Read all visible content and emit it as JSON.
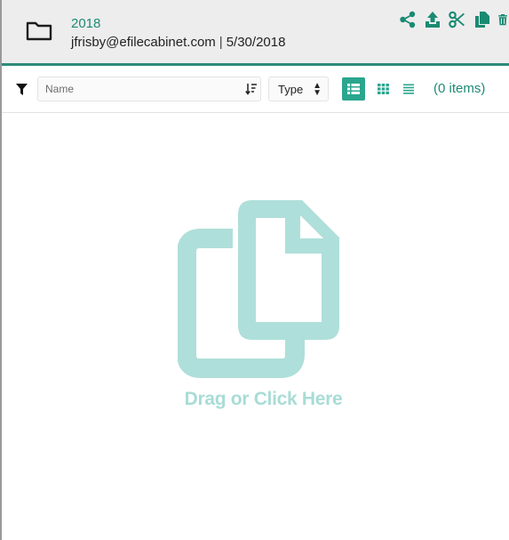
{
  "header": {
    "folder_name": "2018",
    "owner_email": "jfrisby@efilecabinet.com",
    "separator": "|",
    "date": "5/30/2018",
    "accent_color": "#1a8a73",
    "actions": [
      {
        "icon": "share-icon"
      },
      {
        "icon": "upload-icon"
      },
      {
        "icon": "scissors-icon"
      },
      {
        "icon": "copy-icon"
      },
      {
        "icon": "trash-icon"
      }
    ]
  },
  "toolbar": {
    "filter_icon": "filter-icon",
    "name_placeholder": "Name",
    "name_value": "",
    "sort_icon": "sort-icon",
    "sort_glyph": "↓⁼",
    "type_label": "Type",
    "views": [
      "list-view",
      "grid-view",
      "compact-view"
    ],
    "active_view": "list-view",
    "item_count": "(0 items)"
  },
  "dropzone": {
    "icon": "documents-icon",
    "label": "Drag or Click Here",
    "color": "#a9dcd6"
  }
}
